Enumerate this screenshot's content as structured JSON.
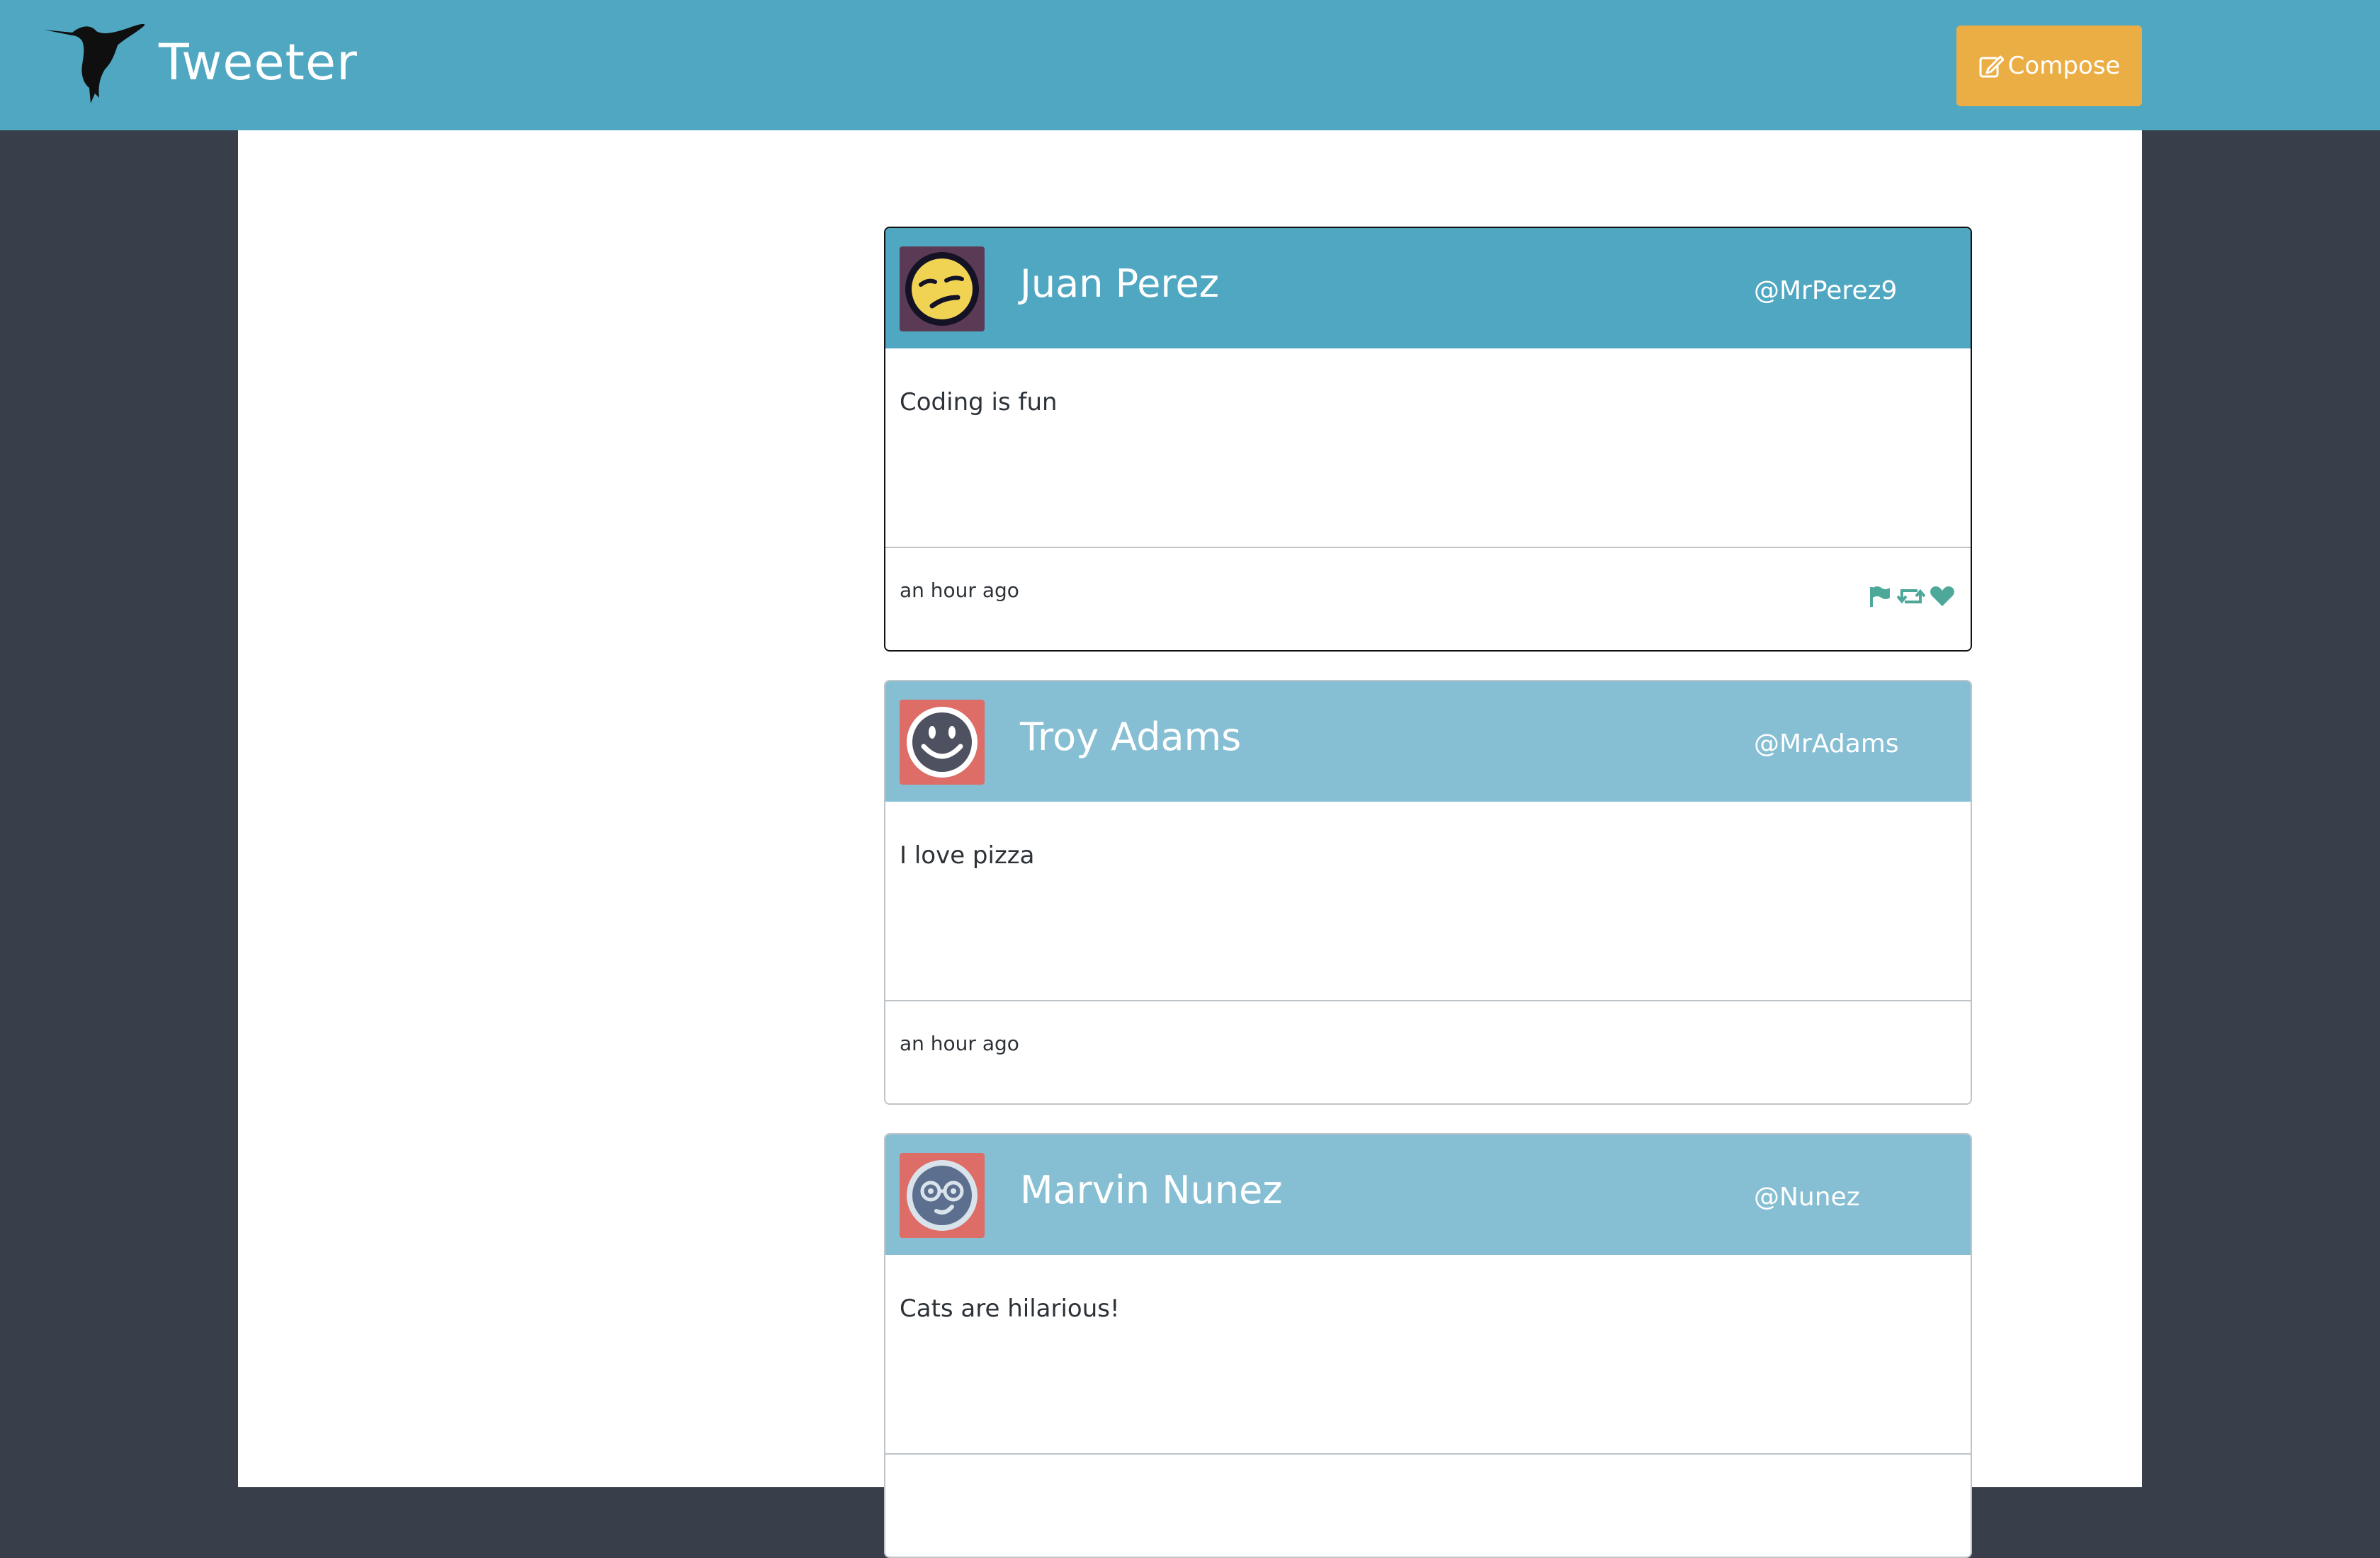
{
  "app": {
    "title": "Tweeter",
    "compose_label": "Compose"
  },
  "colors": {
    "nav_bg": "#4fa7c1",
    "header_faded": "#86bfd3",
    "compose_bg": "#eaae45",
    "side_bg": "#383f4a",
    "action_icon": "#4ea89a"
  },
  "tweets": [
    {
      "name": "Juan Perez",
      "handle": "@MrPerez9",
      "text": "Coding is fun",
      "time": "an hour ago",
      "avatar": "sleepy-face-icon",
      "actions": [
        "flag-icon",
        "retweet-icon",
        "heart-icon"
      ]
    },
    {
      "name": "Troy Adams",
      "handle": "@MrAdams",
      "text": "I love pizza",
      "time": "an hour ago",
      "avatar": "smiley-face-icon"
    },
    {
      "name": "Marvin Nunez",
      "handle": "@Nunez",
      "text": "Cats are hilarious!",
      "avatar": "nerd-face-icon"
    }
  ]
}
